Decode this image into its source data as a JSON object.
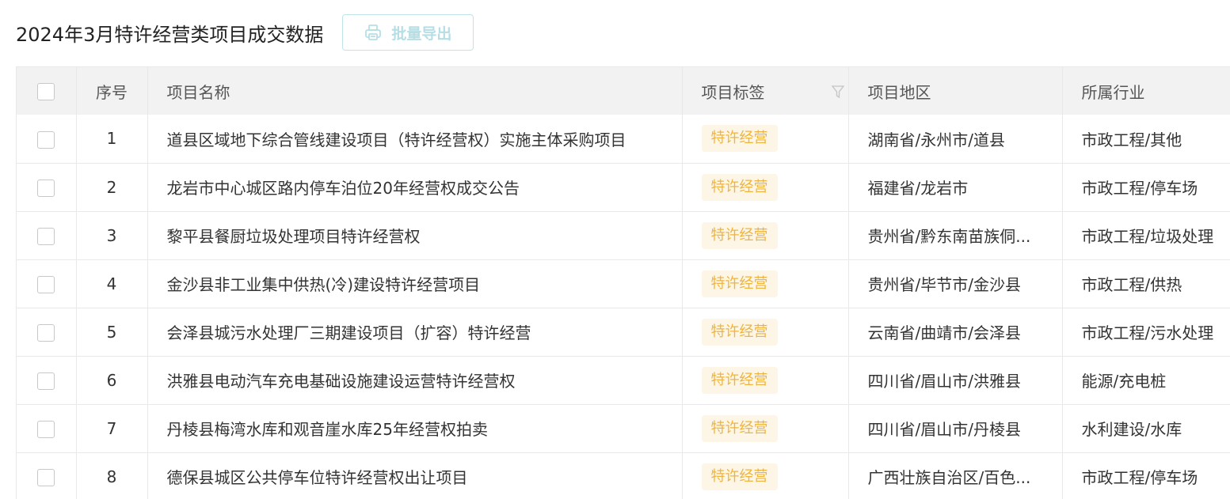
{
  "header": {
    "title": "2024年3月特许经营类项目成交数据",
    "export_label": "批量导出",
    "export_icon": "printer-icon"
  },
  "colors": {
    "tag_bg": "#fdf6e6",
    "tag_text": "#f0b43c",
    "export_text": "#b6dfe5",
    "header_bg": "#f2f2f2"
  },
  "table": {
    "columns": {
      "index": "序号",
      "name": "项目名称",
      "tag": "项目标签",
      "region": "项目地区",
      "industry": "所属行业"
    },
    "filter_icon": "filter-icon",
    "rows": [
      {
        "index": "1",
        "name": "道县区域地下综合管线建设项目（特许经营权）实施主体采购项目",
        "tag": "特许经营",
        "region": "湖南省/永州市/道县",
        "industry": "市政工程/其他"
      },
      {
        "index": "2",
        "name": "龙岩市中心城区路内停车泊位20年经营权成交公告",
        "tag": "特许经营",
        "region": "福建省/龙岩市",
        "industry": "市政工程/停车场"
      },
      {
        "index": "3",
        "name": "黎平县餐厨垃圾处理项目特许经营权",
        "tag": "特许经营",
        "region": "贵州省/黔东南苗族侗...",
        "industry": "市政工程/垃圾处理"
      },
      {
        "index": "4",
        "name": "金沙县非工业集中供热(冷)建设特许经营项目",
        "tag": "特许经营",
        "region": "贵州省/毕节市/金沙县",
        "industry": "市政工程/供热"
      },
      {
        "index": "5",
        "name": "会泽县城污水处理厂三期建设项目（扩容）特许经营",
        "tag": "特许经营",
        "region": "云南省/曲靖市/会泽县",
        "industry": "市政工程/污水处理"
      },
      {
        "index": "6",
        "name": "洪雅县电动汽车充电基础设施建设运营特许经营权",
        "tag": "特许经营",
        "region": "四川省/眉山市/洪雅县",
        "industry": "能源/充电桩"
      },
      {
        "index": "7",
        "name": "丹棱县梅湾水库和观音崖水库25年经营权拍卖",
        "tag": "特许经营",
        "region": "四川省/眉山市/丹棱县",
        "industry": "水利建设/水库"
      },
      {
        "index": "8",
        "name": "德保县城区公共停车位特许经营权出让项目",
        "tag": "特许经营",
        "region": "广西壮族自治区/百色...",
        "industry": "市政工程/停车场"
      }
    ]
  }
}
